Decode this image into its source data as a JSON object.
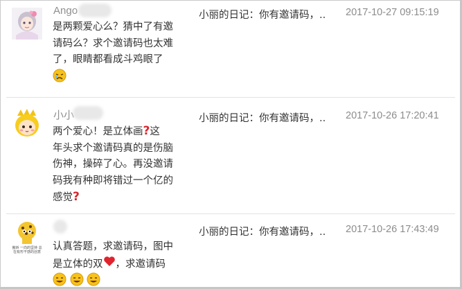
{
  "comments": [
    {
      "username": "Ango",
      "text_lines": [
        "是两颗爱心么？猜中了有邀",
        "请码么？求个邀请码也太难",
        "了，眼睛都看成斗鸡眼了"
      ],
      "post_title": "小丽的日记：你有邀请码，..",
      "date": "2017-10-27 09:15:19"
    },
    {
      "username": "小小",
      "text_line1": "两个爱心！是立体画",
      "text_line1_tail": "这",
      "text_lines_mid": [
        "年头求个邀请码真的是伤脑",
        "伤神，操碎了心。再没邀请",
        "码我有种即将错过一个亿的"
      ],
      "text_last": "感觉",
      "post_title": "小丽的日记：你有邀请码，..",
      "date": "2017-10-26 17:20:41"
    },
    {
      "username": "",
      "avatar_caption": "傲娇 一向的坚持 总在有形干感的创意",
      "text_line1": "认真答题，求邀请码，图中",
      "text_line2_head": "是立体的双",
      "text_line2_tail": "，求邀请码",
      "post_title": "小丽的日记：你有邀请码，..",
      "date": "2017-10-26 17:43:49"
    }
  ],
  "icon_colors": {
    "question": "#d7282f",
    "heart": "#e0242f",
    "emoji": "#f6c21c"
  }
}
